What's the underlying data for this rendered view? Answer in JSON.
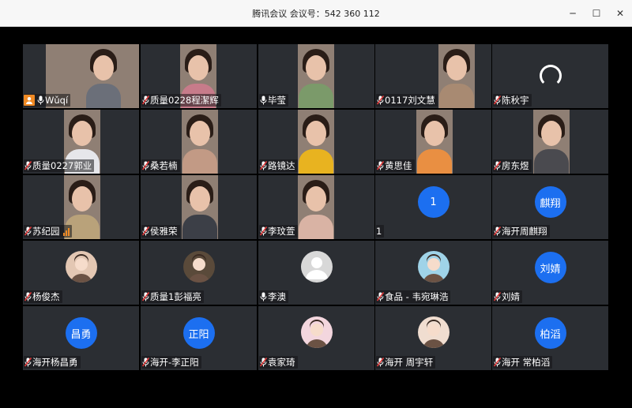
{
  "window": {
    "title": "腾讯会议 会议号：542 360 112",
    "controls": {
      "minimize": "─",
      "maximize": "☐",
      "close": "✕"
    }
  },
  "participants": [
    {
      "name": "Wǔqí",
      "mic": "on",
      "host": true,
      "kind": "video",
      "shirt": "#6b6f79"
    },
    {
      "name": "质量0228程潔辉",
      "mic": "muted",
      "kind": "video",
      "shirt": "#c77b8a"
    },
    {
      "name": "毕莹",
      "mic": "on",
      "kind": "video",
      "shirt": "#7b9a6a"
    },
    {
      "name": "0117刘文慧",
      "mic": "muted",
      "kind": "video",
      "shirt": "#a88a72"
    },
    {
      "name": "陈秋宇",
      "mic": "muted",
      "kind": "spinner"
    },
    {
      "name": "质量0227郭业",
      "mic": "muted",
      "kind": "video",
      "shirt": "#e6e6ea"
    },
    {
      "name": "桑若楠",
      "mic": "muted",
      "kind": "video",
      "shirt": "#c29a85"
    },
    {
      "name": "路镜达",
      "mic": "muted",
      "kind": "video",
      "shirt": "#e8b320"
    },
    {
      "name": "黄思佳",
      "mic": "muted",
      "kind": "video",
      "shirt": "#e98f42"
    },
    {
      "name": "房东煜",
      "mic": "muted",
      "kind": "video",
      "shirt": "#4a4a4f"
    },
    {
      "name": "苏纪园",
      "mic": "muted",
      "kind": "video",
      "shirt": "#b9a27a",
      "signal": true
    },
    {
      "name": "侯雅荣",
      "mic": "muted",
      "kind": "video",
      "shirt": "#3c3f47"
    },
    {
      "name": "李玟萱",
      "mic": "muted",
      "kind": "video",
      "shirt": "#d9b3a4"
    },
    {
      "name": "1",
      "mic": "none",
      "kind": "initial",
      "avatar_text": "1"
    },
    {
      "name": "海开周麒翔",
      "mic": "muted",
      "kind": "initial",
      "avatar_text": "麒翔"
    },
    {
      "name": "杨俊杰",
      "mic": "muted",
      "kind": "photo",
      "photo_bg": "#e3c7b3"
    },
    {
      "name": "质量1彭福亮",
      "mic": "muted",
      "kind": "photo",
      "photo_bg": "#5a4a3a"
    },
    {
      "name": "李澳",
      "mic": "on",
      "kind": "photo",
      "photo_bg": "#d8d8d8",
      "default": true
    },
    {
      "name": "食品 - 韦宛琳浩",
      "mic": "muted",
      "kind": "photo",
      "photo_bg": "#9fd3e8"
    },
    {
      "name": "刘婧",
      "mic": "muted",
      "kind": "initial",
      "avatar_text": "刘婧"
    },
    {
      "name": "海开杨昌勇",
      "mic": "muted",
      "kind": "initial",
      "avatar_text": "昌勇"
    },
    {
      "name": "海开-李正阳",
      "mic": "muted",
      "kind": "initial",
      "avatar_text": "正阳"
    },
    {
      "name": "袁家琦",
      "mic": "muted",
      "kind": "photo",
      "photo_bg": "#f3d6de"
    },
    {
      "name": "海开 周宇轩",
      "mic": "muted",
      "kind": "photo",
      "photo_bg": "#f0ddd0"
    },
    {
      "name": "海开 常柏滔",
      "mic": "muted",
      "kind": "initial",
      "avatar_text": "柏滔"
    }
  ],
  "colors": {
    "tile": "#2b2e33",
    "avatar": "#1c6ff0",
    "mute": "#e23b3b",
    "host": "#f08a24"
  }
}
